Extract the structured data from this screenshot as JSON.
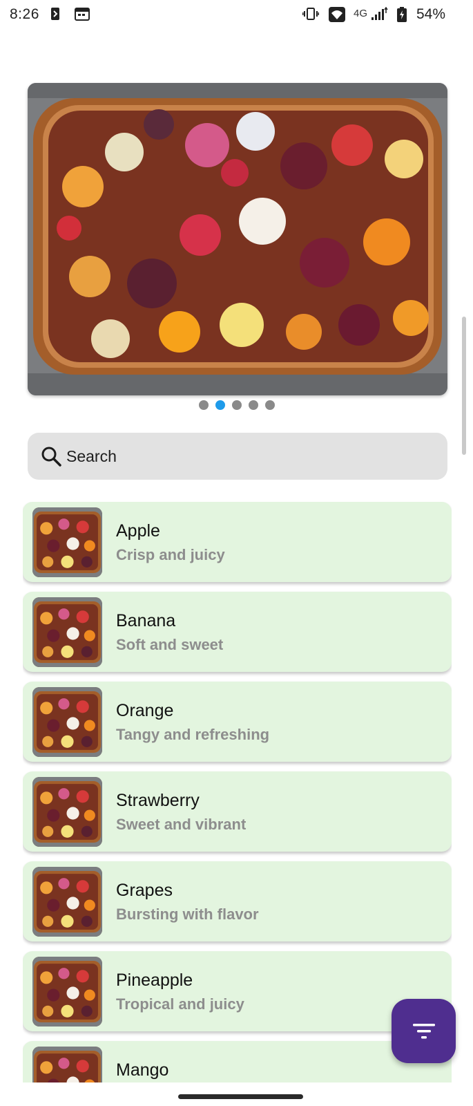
{
  "status_bar": {
    "time": "8:26",
    "network": "4G",
    "battery": "54%",
    "icons": [
      "dash-icon",
      "calendar-icon",
      "vibrate-icon",
      "wifi-icon",
      "signal-icon",
      "battery-charging-icon"
    ]
  },
  "carousel": {
    "image": "fruit-platter-image",
    "total_pages": 5,
    "active_page": 2
  },
  "search": {
    "placeholder": "Search",
    "icon": "search-icon"
  },
  "items": [
    {
      "name": "Apple",
      "description": "Crisp and juicy"
    },
    {
      "name": "Banana",
      "description": "Soft and sweet"
    },
    {
      "name": "Orange",
      "description": "Tangy and refreshing"
    },
    {
      "name": "Strawberry",
      "description": "Sweet and vibrant"
    },
    {
      "name": "Grapes",
      "description": "Bursting with flavor"
    },
    {
      "name": "Pineapple",
      "description": "Tropical and juicy"
    },
    {
      "name": "Mango",
      "description": ""
    }
  ],
  "fab": {
    "icon": "filter-icon"
  },
  "colors": {
    "card_background": "#e3f5df",
    "fab_background": "#4f2e8f",
    "dot_active": "#1e9bea",
    "dot_inactive": "#8a8a8a",
    "search_background": "#e2e2e2"
  }
}
